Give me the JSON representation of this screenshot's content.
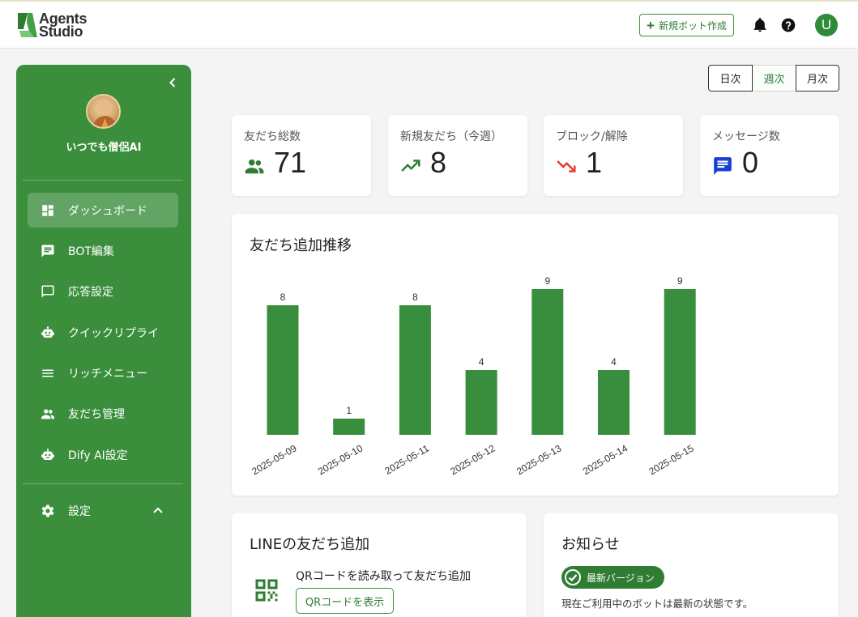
{
  "header": {
    "logo_line1": "Agents",
    "logo_line2": "Studio",
    "new_bot_label": "新規ボット作成",
    "user_initial": "U"
  },
  "sidebar": {
    "bot_name": "いつでも僧侶AI",
    "items": [
      {
        "label": "ダッシュボード",
        "icon": "dashboard-icon"
      },
      {
        "label": "BOT編集",
        "icon": "message-edit-icon"
      },
      {
        "label": "応答設定",
        "icon": "chat-bubble-icon"
      },
      {
        "label": "クイックリプライ",
        "icon": "robot-icon"
      },
      {
        "label": "リッチメニュー",
        "icon": "menu-lines-icon"
      },
      {
        "label": "友だち管理",
        "icon": "people-icon"
      },
      {
        "label": "Dify AI設定",
        "icon": "robot-icon"
      }
    ],
    "settings_label": "設定"
  },
  "period": {
    "day": "日次",
    "week": "週次",
    "month": "月次",
    "selected": "週次"
  },
  "stats": [
    {
      "label": "友だち総数",
      "value": "71",
      "icon": "people-icon",
      "color": "#2e7d32"
    },
    {
      "label": "新規友だち（今週）",
      "value": "8",
      "icon": "trending-up-icon",
      "color": "#2e7d32"
    },
    {
      "label": "ブロック/解除",
      "value": "1",
      "icon": "trending-down-icon",
      "color": "#e53935"
    },
    {
      "label": "メッセージ数",
      "value": "0",
      "icon": "message-icon",
      "color": "#1a3fd6"
    }
  ],
  "chart_title": "友だち追加推移",
  "chart_data": {
    "type": "bar",
    "categories": [
      "2025-05-09",
      "2025-05-10",
      "2025-05-11",
      "2025-05-12",
      "2025-05-13",
      "2025-05-14",
      "2025-05-15"
    ],
    "values": [
      8,
      1,
      8,
      4,
      9,
      4,
      9
    ],
    "title": "友だち追加推移",
    "bar_color": "#388e3c",
    "ylim": [
      0,
      9
    ],
    "grid": false
  },
  "line_card": {
    "title": "LINEの友だち追加",
    "text": "QRコードを読み取って友だち追加",
    "button": "QRコードを表示"
  },
  "news_card": {
    "title": "お知らせ",
    "badge": "最新バージョン",
    "text": "現在ご利用中のボットは最新の状態です。"
  }
}
